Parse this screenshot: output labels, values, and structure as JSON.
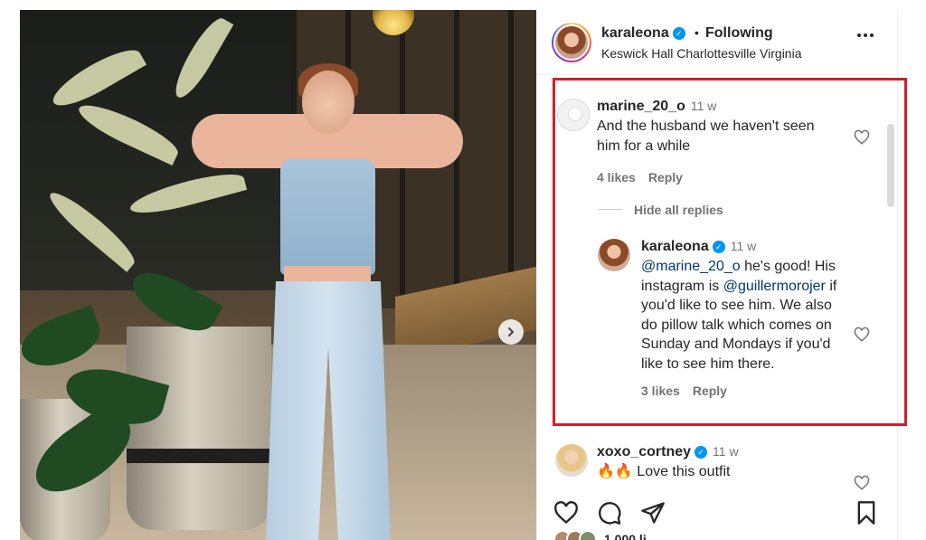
{
  "header": {
    "username": "karaleona",
    "separator": "•",
    "follow_status": "Following",
    "location": "Keswick Hall Charlottesville Virginia"
  },
  "comments": [
    {
      "username": "marine_20_o",
      "time": "11 w",
      "text": "And the husband we haven't seen him for a while",
      "likes": "4 likes",
      "reply": "Reply"
    }
  ],
  "thread": {
    "hide_replies": "Hide all replies",
    "reply": {
      "username": "karaleona",
      "time": "11 w",
      "mention1": "@marine_20_o",
      "text1": " he's good! His instagram is ",
      "mention2": "@guillermorojer",
      "text2": " if you'd like to see him. We also do pillow talk which comes on Sunday and Mondays if you'd like to see him there.",
      "likes": "3 likes",
      "reply_label": "Reply"
    }
  },
  "next_comment": {
    "username": "xoxo_cortney",
    "time": "11 w",
    "text": "🔥🔥 Love this outfit"
  },
  "icons": {
    "verified": "verified-badge-icon",
    "more": "more-options-icon",
    "heart": "heart-icon",
    "comment": "comment-icon",
    "share": "share-icon",
    "save": "bookmark-icon",
    "next": "chevron-right-icon"
  },
  "colors": {
    "highlight_border": "#d21f2b",
    "verified": "#0095f6",
    "mention": "#00376b"
  },
  "likes_partial": "1,000 li"
}
